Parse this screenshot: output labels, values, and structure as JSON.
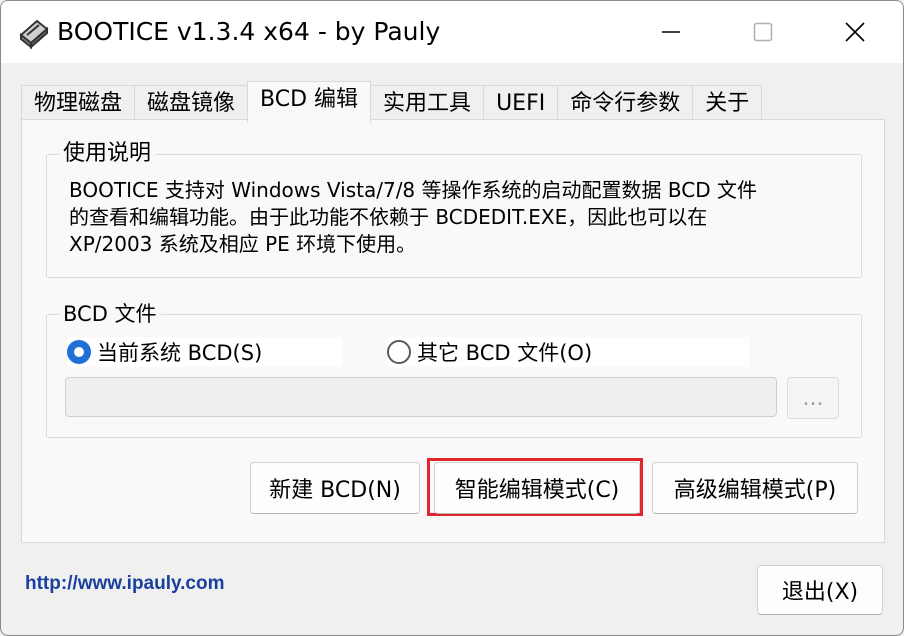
{
  "window": {
    "title": "BOOTICE v1.3.4 x64 - by Pauly",
    "app_icon": "drive-icon",
    "controls": [
      "minimize-icon",
      "maximize-icon",
      "close-icon"
    ]
  },
  "tabs": [
    {
      "label": "物理磁盘",
      "active": false
    },
    {
      "label": "磁盘镜像",
      "active": false
    },
    {
      "label": "BCD 编辑",
      "active": true
    },
    {
      "label": "实用工具",
      "active": false
    },
    {
      "label": "UEFI",
      "active": false
    },
    {
      "label": "命令行参数",
      "active": false
    },
    {
      "label": "关于",
      "active": false
    }
  ],
  "usage": {
    "legend": "使用说明",
    "text": "BOOTICE 支持对 Windows Vista/7/8 等操作系统的启动配置数据 BCD 文件\n的查看和编辑功能。由于此功能不依赖于 BCDEDIT.EXE，因此也可以在\nXP/2003 系统及相应 PE 环境下使用。"
  },
  "bcd_file": {
    "legend": "BCD 文件",
    "option_current": "当前系统 BCD(S)",
    "option_other": "其它 BCD 文件(O)",
    "selected": "current",
    "path_value": "",
    "browse_label": "..."
  },
  "buttons": {
    "new_bcd": "新建 BCD(N)",
    "smart_edit": "智能编辑模式(C)",
    "advanced_edit": "高级编辑模式(P)",
    "exit": "退出(X)"
  },
  "footer": {
    "link": "http://www.ipauly.com"
  },
  "colors": {
    "highlight": "#e0262d",
    "radio_checked": "#1f6fd6",
    "link": "#1a3f9c"
  }
}
